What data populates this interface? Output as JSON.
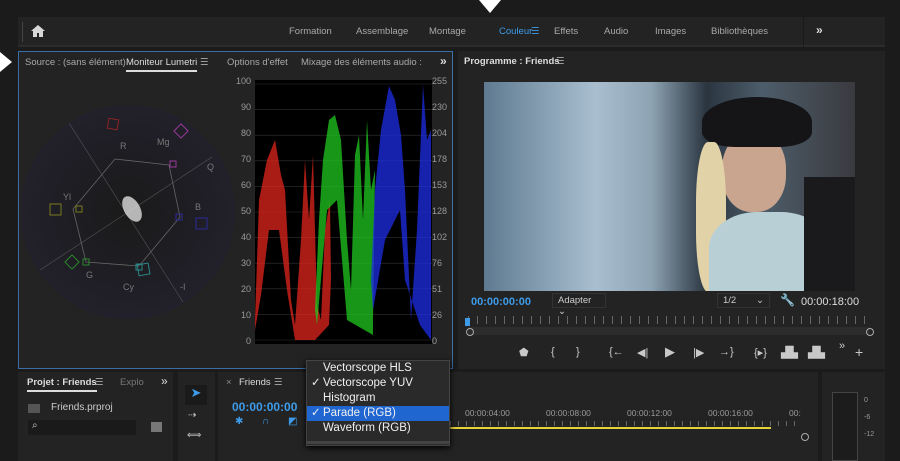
{
  "workspaces": [
    "Formation",
    "Assemblage",
    "Montage",
    "Couleur",
    "Effets",
    "Audio",
    "Images",
    "Bibliothèques"
  ],
  "active_workspace": "Couleur",
  "left_tabs": {
    "source": "Source : (sans élément)",
    "lumetri": "Moniteur Lumetri",
    "effects": "Options d'effet",
    "audio_mix": "Mixage des éléments audio :"
  },
  "vectorscope_labels": {
    "r": "R",
    "mg": "Mg",
    "q": "Q",
    "yl": "Yl",
    "b": "B",
    "g": "G",
    "cy": "Cy",
    "i": "-I"
  },
  "parade_left_axis": [
    "100",
    "90",
    "80",
    "70",
    "60",
    "50",
    "40",
    "30",
    "20",
    "10",
    "0"
  ],
  "parade_right_axis": [
    "255",
    "230",
    "204",
    "178",
    "153",
    "128",
    "102",
    "76",
    "51",
    "26",
    "0"
  ],
  "program": {
    "title": "Programme : Friends",
    "timecode": "00:00:00:00",
    "fit": "Adapter",
    "resolution": "1/2",
    "duration": "00:00:18:00"
  },
  "project": {
    "title": "Projet : Friends",
    "tab2": "Explo",
    "file": "Friends.prproj",
    "search_placeholder": ""
  },
  "timeline": {
    "title": "Friends",
    "timecode": "00:00:00:00",
    "ticks": [
      "00:00:04:00",
      "00:00:08:00",
      "00:00:12:00",
      "00:00:16:00",
      "00:"
    ]
  },
  "meter_labels": [
    "0",
    "-6",
    "-12"
  ],
  "menu": [
    {
      "label": "Vectorscope HLS",
      "checked": false,
      "selected": false
    },
    {
      "label": "Vectorscope YUV",
      "checked": true,
      "selected": false
    },
    {
      "label": "Histogram",
      "checked": false,
      "selected": false
    },
    {
      "label": "Parade (RGB)",
      "checked": true,
      "selected": true
    },
    {
      "label": "Waveform (RGB)",
      "checked": false,
      "selected": false
    }
  ],
  "checkmark": "✓",
  "colors": {
    "accent": "#3d9be9",
    "selection": "#1f66d1",
    "panel_border": "#3b6fa8"
  }
}
